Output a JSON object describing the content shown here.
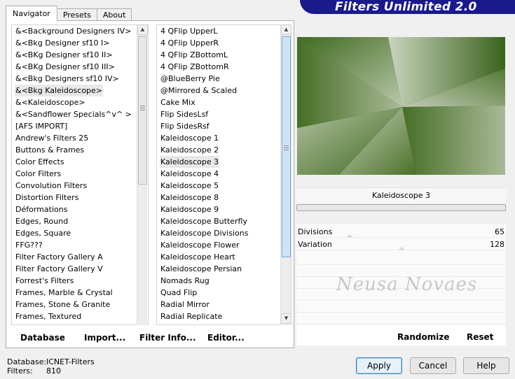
{
  "header": {
    "title": "Filters Unlimited 2.0"
  },
  "tabs": [
    {
      "label": "Navigator",
      "active": true
    },
    {
      "label": "Presets",
      "active": false
    },
    {
      "label": "About",
      "active": false
    }
  ],
  "categories": {
    "selected_index": 5,
    "items": [
      "&<Background Designers IV>",
      "&<Bkg Designer sf10 I>",
      "&<BKg Designer sf10 II>",
      "&<BKg Designer sf10 III>",
      "&<Bkg Designers sf10 IV>",
      "&<Bkg Kaleidoscope>",
      "&<Kaleidoscope>",
      "&<Sandflower Specials^v^ >",
      "[AFS IMPORT]",
      "Andrew's Filters 25",
      "Buttons & Frames",
      "Color Effects",
      "Color Filters",
      "Convolution Filters",
      "Distortion Filters",
      "Déformations",
      "Edges, Round",
      "Edges, Square",
      "FFG???",
      "Filter Factory Gallery A",
      "Filter Factory Gallery V",
      "Forrest's Filters",
      "Frames, Marble & Crystal",
      "Frames, Stone & Granite",
      "Frames, Textured"
    ]
  },
  "filters": {
    "selected_index": 11,
    "items": [
      "4 QFlip UpperL",
      "4 QFlip UpperR",
      "4 QFlip ZBottomL",
      "4 QFlip ZBottomR",
      "@BlueBerry Pie",
      "@Mirrored & Scaled",
      "Cake Mix",
      "Flip SidesLsf",
      "Flip SidesRsf",
      "Kaleidoscope 1",
      "Kaleidoscope 2",
      "Kaleidoscope 3",
      "Kaleidoscope 4",
      "Kaleidoscope 5",
      "Kaleidoscope 8",
      "Kaleidoscope 9",
      "Kaleidoscope Butterfly",
      "Kaleidoscope Divisions",
      "Kaleidoscope Flower",
      "Kaleidoscope Heart",
      "Kaleidoscope Persian",
      "Nomads Rug",
      "Quad Flip",
      "Radial Mirror",
      "Radial Replicate"
    ]
  },
  "toolbar": {
    "database": "Database",
    "import": "Import...",
    "filter_info": "Filter Info...",
    "editor": "Editor..."
  },
  "preview": {
    "filter_name": "Kaleidoscope 3"
  },
  "params": [
    {
      "name": "Divisions",
      "value": "65",
      "level": 0.255
    },
    {
      "name": "Variation",
      "value": "128",
      "level": 0.502
    }
  ],
  "watermark": "Neusa Novaes",
  "right_actions": {
    "randomize": "Randomize",
    "reset": "Reset"
  },
  "status": {
    "database_label": "Database:",
    "database_value": "ICNET-Filters",
    "filters_label": "Filters:",
    "filters_value": "810"
  },
  "buttons": {
    "apply": "Apply",
    "cancel": "Cancel",
    "help": "Help"
  },
  "colors": {
    "banner": "#1a1a8c",
    "preview_dark": "#3f6622",
    "preview_light": "#c7d1bd"
  }
}
